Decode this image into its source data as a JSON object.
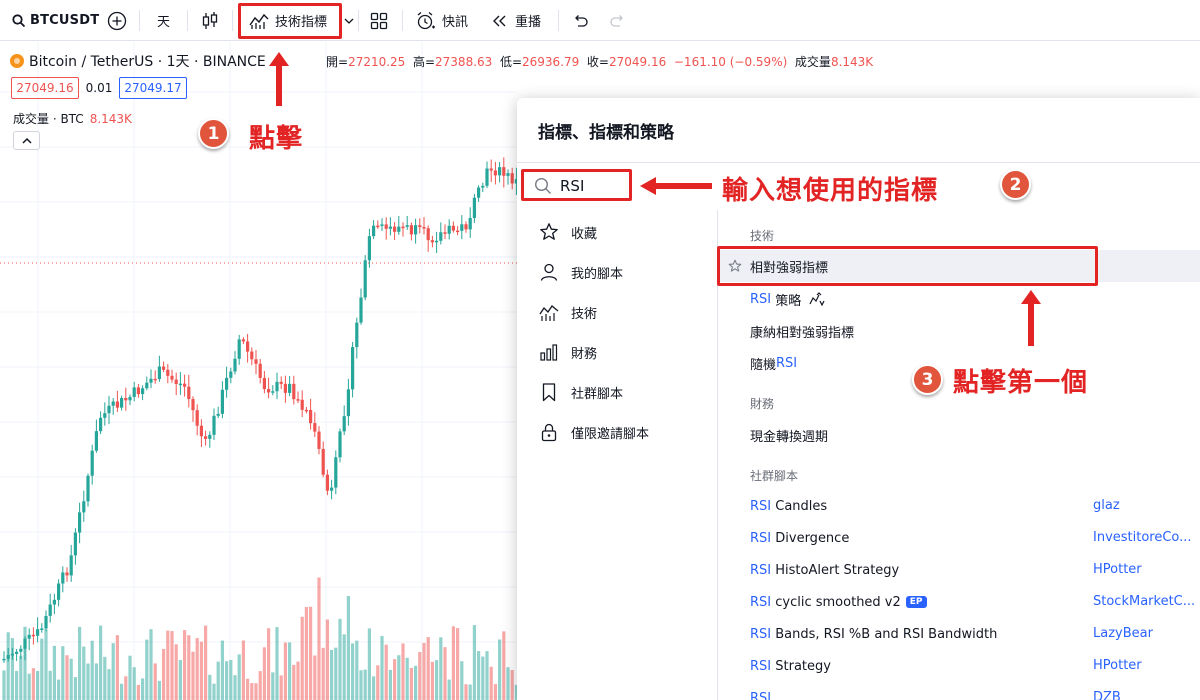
{
  "toolbar": {
    "symbol": "BTCUSDT",
    "interval": "天",
    "indicators_label": "技術指標",
    "alert_label": "快訊",
    "replay_label": "重播"
  },
  "legend": {
    "pair": "Bitcoin / TetherUS · 1天 · BINANCE",
    "open_label": "開=",
    "open": "27210.25",
    "high_label": "高=",
    "high": "27388.63",
    "low_label": "低=",
    "low": "26936.79",
    "close_label": "收=",
    "close": "27049.16",
    "change": "−161.10 (−0.59%)",
    "volume_label": "成交量",
    "volume": "8.143K",
    "bid": "27049.16",
    "spread": "0.01",
    "ask": "27049.17",
    "vol_pane_label": "成交量 · BTC",
    "vol_pane_value": "8.143K"
  },
  "colors": {
    "up": "#26a69a",
    "down": "#ef5350",
    "accent": "#2962ff",
    "annotation": "#e32424"
  },
  "annotations": {
    "step1_num": "1",
    "step1_text": "點擊",
    "step2_num": "2",
    "step2_text": "輸入想使用的指標",
    "step3_num": "3",
    "step3_text": "點擊第一個"
  },
  "dialog": {
    "title": "指標、指標和策略",
    "search_value": "RSI",
    "sidebar": [
      {
        "label": "收藏",
        "icon": "star-icon"
      },
      {
        "label": "我的腳本",
        "icon": "user-icon"
      },
      {
        "label": "技術",
        "icon": "chart-line-icon"
      },
      {
        "label": "財務",
        "icon": "bar-chart-icon"
      },
      {
        "label": "社群腳本",
        "icon": "bookmark-icon"
      },
      {
        "label": "僅限邀請腳本",
        "icon": "lock-icon"
      }
    ],
    "sections": {
      "technical": "技術",
      "financial": "財務",
      "community": "社群腳本"
    },
    "technical_results": [
      {
        "label": "相對強弱指標"
      },
      {
        "hl": "RSI",
        "rest": " 策略"
      },
      {
        "label": "康納相對強弱指標"
      },
      {
        "pre": "隨機",
        "hl": "RSI"
      }
    ],
    "financial_results": [
      {
        "label": "現金轉換週期"
      }
    ],
    "community_results": [
      {
        "hl": "RSI",
        "rest": " Candles",
        "author": "glaz"
      },
      {
        "hl": "RSI",
        "rest": " Divergence",
        "author": "InvestitoreCo..."
      },
      {
        "hl": "RSI",
        "rest": " HistoAlert Strategy",
        "author": "HPotter"
      },
      {
        "hl": "RSI",
        "rest": " cyclic smoothed v2",
        "badge": "EP",
        "author": "StockMarketC..."
      },
      {
        "hl": "RSI",
        "rest": " Bands, RSI %B and RSI Bandwidth",
        "author": "LazyBear"
      },
      {
        "hl": "RSI",
        "rest": " Strategy",
        "author": "HPotter"
      },
      {
        "hl": "RSI",
        "rest": "",
        "author": "DZB"
      }
    ]
  }
}
